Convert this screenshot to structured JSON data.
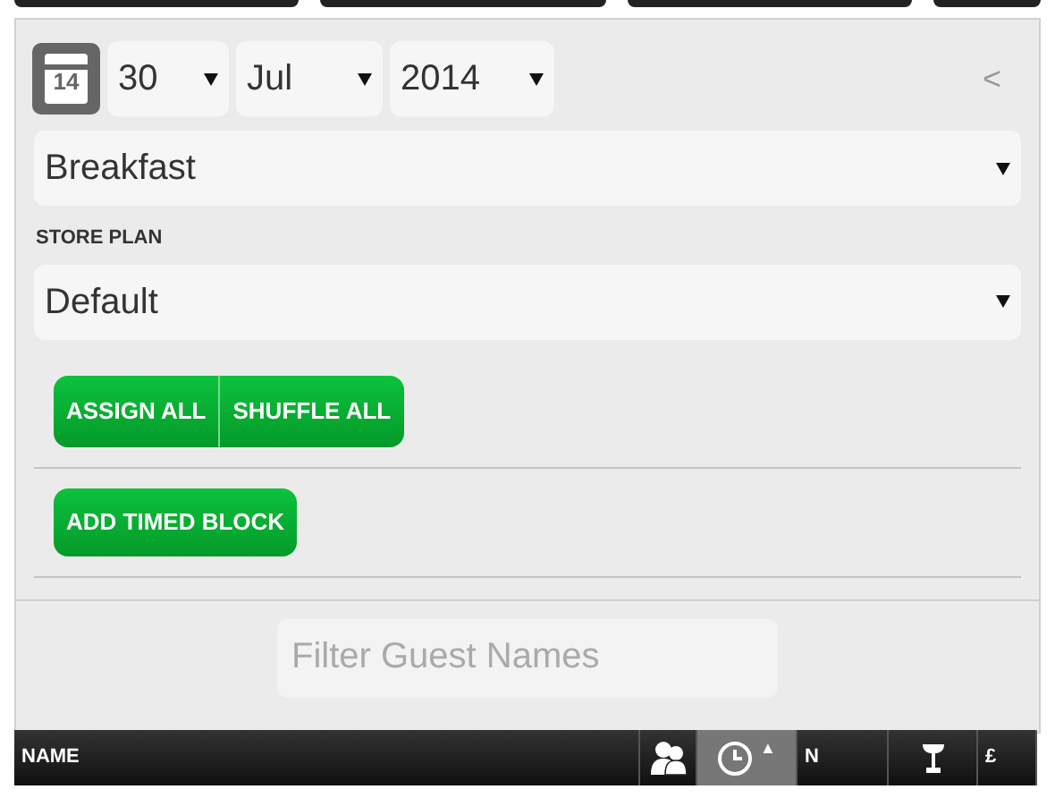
{
  "date": {
    "calendar_day": "14",
    "day": "30",
    "month": "Jul",
    "year": "2014",
    "collapse": "<"
  },
  "meal_select": {
    "value": "Breakfast"
  },
  "store_plan": {
    "label": "STORE PLAN",
    "value": "Default"
  },
  "buttons": [
    "ASSIGN ALL",
    "SHUFFLE ALL"
  ],
  "timed_block_button": "ADD TIMED BLOCK",
  "filter": {
    "placeholder": "Filter Guest Names"
  },
  "columns": [
    {
      "kind": "text",
      "label": "NAME",
      "selected": false
    },
    {
      "kind": "people",
      "selected": false
    },
    {
      "kind": "clock",
      "selected": true,
      "sort": "▲"
    },
    {
      "kind": "text",
      "label": "N",
      "selected": false
    },
    {
      "kind": "glass",
      "selected": false
    },
    {
      "kind": "text",
      "label": "£",
      "selected": false
    }
  ]
}
